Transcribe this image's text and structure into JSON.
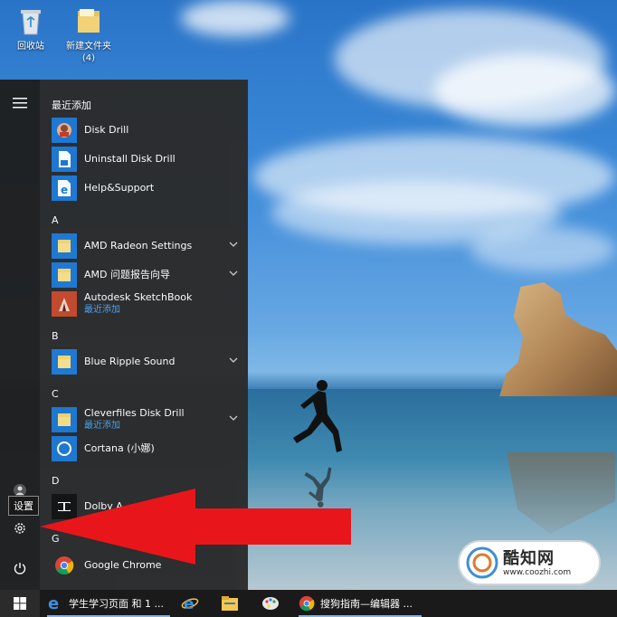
{
  "desktop": {
    "icons": [
      {
        "label": "回收站"
      },
      {
        "label": "新建文件夹\n(4)"
      }
    ]
  },
  "start_menu": {
    "tooltip": "设置",
    "sections": [
      {
        "header": "最近添加",
        "items": [
          {
            "name": "Disk Drill",
            "sub": ""
          },
          {
            "name": "Uninstall Disk Drill",
            "sub": ""
          },
          {
            "name": "Help&Support",
            "sub": ""
          }
        ]
      },
      {
        "header": "A",
        "items": [
          {
            "name": "AMD Radeon Settings",
            "sub": ""
          },
          {
            "name": "AMD 问题报告向导",
            "sub": ""
          },
          {
            "name": "Autodesk SketchBook",
            "sub": "最近添加"
          }
        ]
      },
      {
        "header": "B",
        "items": [
          {
            "name": "Blue Ripple Sound",
            "sub": ""
          }
        ]
      },
      {
        "header": "C",
        "items": [
          {
            "name": "Cleverfiles Disk Drill",
            "sub": "最近添加"
          },
          {
            "name": "Cortana (小娜)",
            "sub": ""
          }
        ]
      },
      {
        "header": "D",
        "items": [
          {
            "name": "Dolby A",
            "sub": ""
          }
        ]
      },
      {
        "header": "G",
        "items": [
          {
            "name": "Google Chrome",
            "sub": ""
          }
        ]
      }
    ]
  },
  "taskbar": {
    "items": [
      {
        "label": "学生学习页面 和 1 ..."
      },
      {
        "label": ""
      },
      {
        "label": ""
      },
      {
        "label": ""
      },
      {
        "label": "搜狗指南—编辑器 ..."
      }
    ]
  },
  "watermark": {
    "title": "酷知网",
    "url": "www.coozhi.com"
  },
  "colors": {
    "accent_tile": "#1e78d2",
    "sub_text": "#4ea3ee",
    "arrow": "#e8161a"
  }
}
